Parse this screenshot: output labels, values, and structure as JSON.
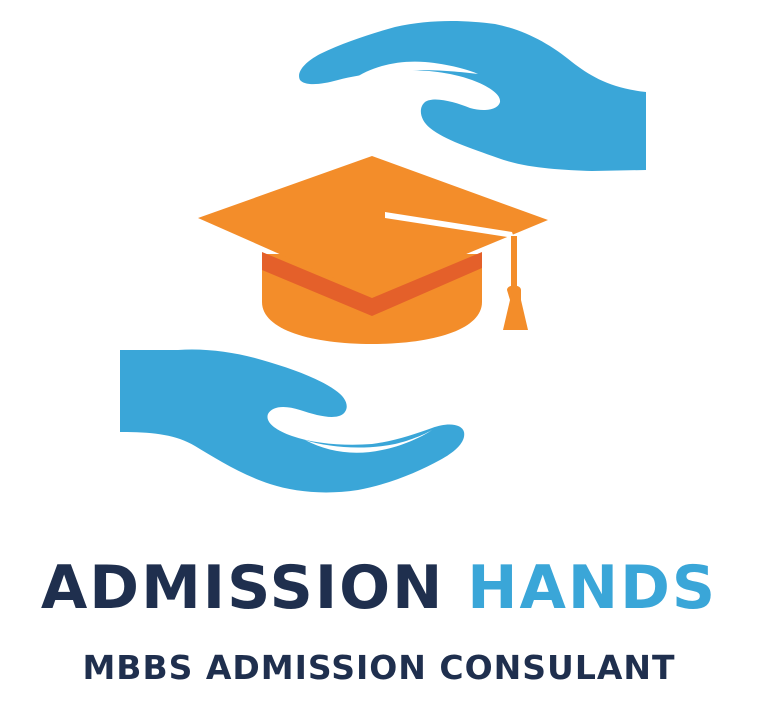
{
  "brand": {
    "name_part_1": "ADMISSION",
    "name_part_2": "HANDS",
    "tagline": "MBBS ADMISSION CONSULANT"
  },
  "logo": {
    "icons": [
      "hand-icon",
      "graduation-cap-icon",
      "hand-icon"
    ],
    "colors": {
      "hand": "#3aa6d8",
      "cap_top": "#f38d2a",
      "cap_body": "#f38d2a",
      "cap_band": "#e4602a",
      "text_dark": "#1f2f4e",
      "text_accent": "#3aa6d8"
    }
  }
}
